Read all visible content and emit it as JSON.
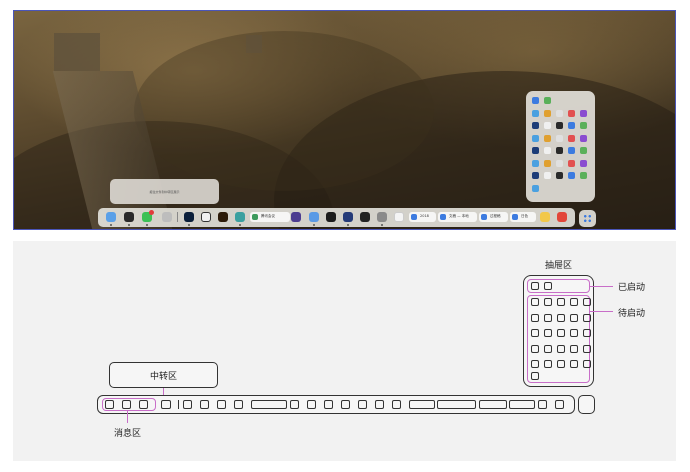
{
  "desktop": {
    "transfer_popup_text": "拖住文件到中转区展示",
    "dock_pills": [
      {
        "label": "腾讯会议"
      },
      {
        "label": "2018"
      },
      {
        "label": "文稿 — 本地"
      },
      {
        "label": "过程稿"
      },
      {
        "label": "日色"
      }
    ]
  },
  "diagram": {
    "drawer_label": "抽屉区",
    "launched_label": "已启动",
    "pending_label": "待启动",
    "transfer_label": "中转区",
    "message_label": "消息区"
  },
  "colors": {
    "frame_border": "#4a55b8",
    "annotation_line": "#c86ec8",
    "diagram_bg": "#f2f2f2"
  }
}
